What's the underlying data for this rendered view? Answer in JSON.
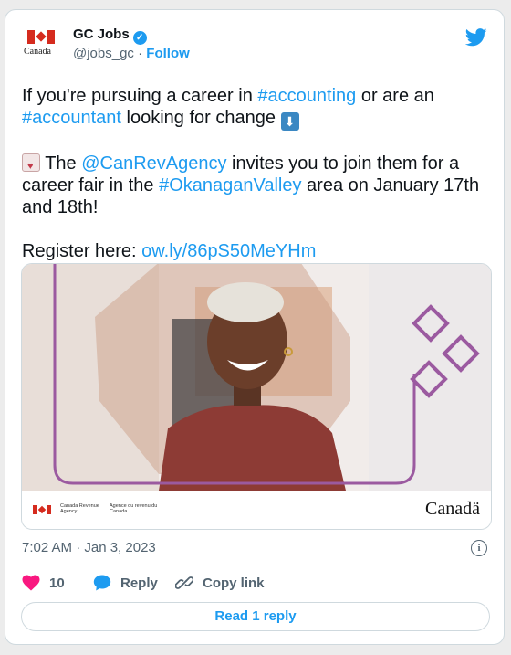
{
  "account": {
    "name": "GC Jobs",
    "handle": "@jobs_gc",
    "separator": "·",
    "follow_label": "Follow",
    "logo_wordmark": "Canadä"
  },
  "tweet": {
    "line1_pre": "If you're pursuing a career in ",
    "hashtag_accounting": "#accounting",
    "line1_mid": " or are an ",
    "hashtag_accountant": "#accountant",
    "line1_post": " looking for change ",
    "line2_pre": " The ",
    "mention": "@CanRevAgency",
    "line2_mid": " invites you to join them for a career fair in the ",
    "hashtag_okanagan": "#OkanaganValley",
    "line2_post": " area on January 17th and 18th!",
    "register_label": "Register here: ",
    "register_link": "ow.ly/86pS50MeYHm"
  },
  "media": {
    "agency_en": "Canada Revenue Agency",
    "agency_fr": "Agence du revenu du Canada",
    "wordmark": "Canadä"
  },
  "timestamp": "7:02 AM · Jan 3, 2023",
  "actions": {
    "like_count": "10",
    "reply_label": "Reply",
    "copy_label": "Copy link"
  },
  "read_reply_label": "Read 1 reply",
  "colors": {
    "accent": "#1d9bf0",
    "like": "#f91880",
    "canada_red": "#d52b1e",
    "frame_purple": "#9b5aa0"
  }
}
